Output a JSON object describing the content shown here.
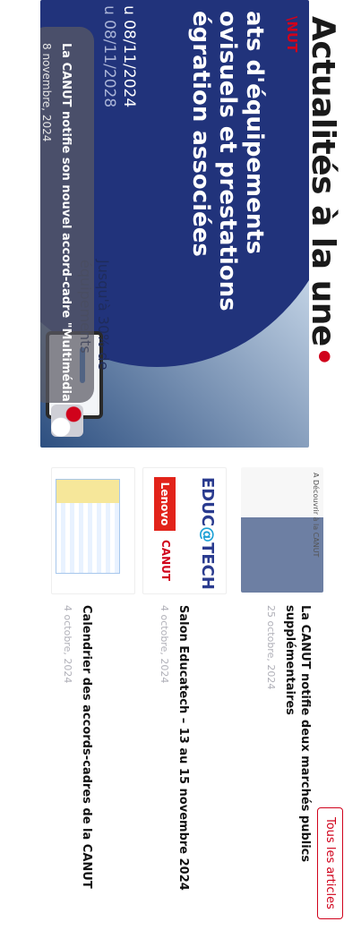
{
  "section": {
    "title": "Actualités à la une",
    "title_dot": "•",
    "all_articles_label": "Tous les articles"
  },
  "hero": {
    "logo_fragment": "\\NUT",
    "headline": "ats d'équipements ovisuels et prestations égration associées",
    "date_line_1": "u 08/11/2024",
    "date_line_2": "u 08/11/2028",
    "promo": "Jusqu'à 30% de équipements",
    "caption_title": "La CANUT notifie son nouvel accord-cadre \"Multimédia\"",
    "caption_date": "8 novembre, 2024"
  },
  "articles": [
    {
      "thumb_caption": "A Découvrir à la CANUT",
      "title": "La CANUT notifie deux marchés publics supplémentaires",
      "date": "25 octobre, 2024"
    },
    {
      "thumb_text_1": "EDUC",
      "thumb_text_at": "@",
      "thumb_text_2": "TECH",
      "thumb_lenovo": "Lenovo",
      "thumb_canut": "CANUT",
      "title": "Salon Educatech – 13 au 15 novembre 2024",
      "date": "4 octobre, 2024"
    },
    {
      "title": "Calendrier des accords-cadres de la CANUT",
      "date": "4 octobre, 2024"
    }
  ],
  "colors": {
    "accent": "#d0021b",
    "hero_blue": "#21337b"
  }
}
